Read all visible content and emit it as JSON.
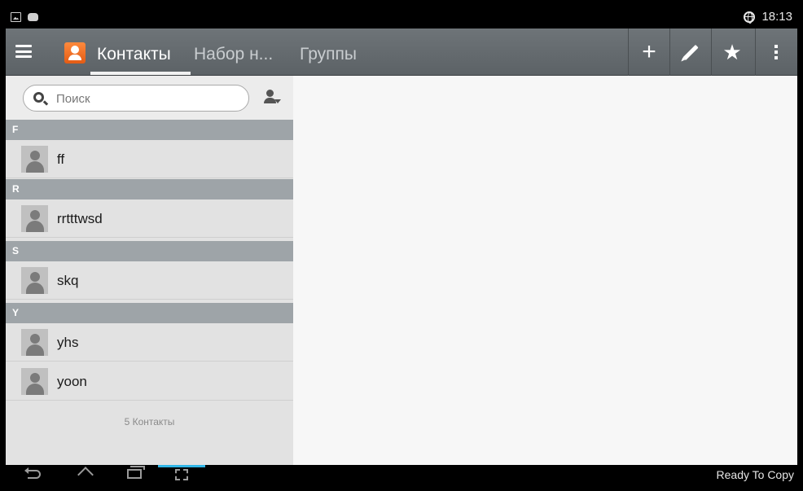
{
  "status_bar": {
    "time": "18:13",
    "icons": [
      "image-notification-icon",
      "cat-notification-icon",
      "globe-icon"
    ]
  },
  "action_bar": {
    "tabs": [
      {
        "label": "Контакты",
        "active": true
      },
      {
        "label": "Набор н...",
        "active": false
      },
      {
        "label": "Группы",
        "active": false
      }
    ],
    "actions": [
      "add-icon",
      "edit-icon",
      "favorite-star-icon",
      "overflow-menu-icon"
    ]
  },
  "search": {
    "placeholder": "Поиск"
  },
  "contacts": {
    "sections": [
      {
        "letter": "F",
        "names": [
          "ff"
        ]
      },
      {
        "letter": "R",
        "names": [
          "rrtttwsd"
        ]
      },
      {
        "letter": "S",
        "names": [
          "skq"
        ]
      },
      {
        "letter": "Y",
        "names": [
          "yhs",
          "yoon"
        ]
      }
    ],
    "count_label": "5 Контакты"
  },
  "nav_bar": {
    "buttons": [
      "back-icon",
      "home-icon",
      "recent-apps-icon",
      "screenshot-icon"
    ],
    "status_text": "Ready To Copy"
  },
  "colors": {
    "action_bar": "#62686c",
    "section_header": "#9ea4a8",
    "nav_highlight": "#31b6e7",
    "app_icon": "#f07325"
  }
}
